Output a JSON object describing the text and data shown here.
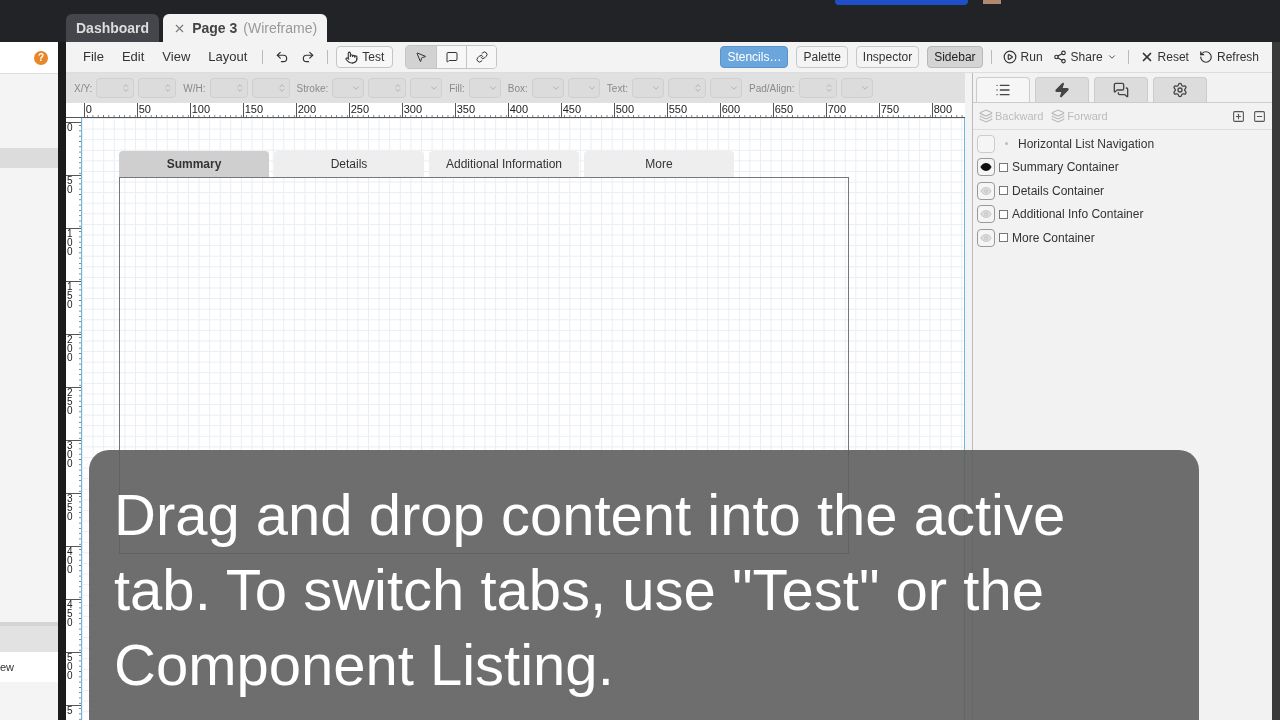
{
  "app_tabs": [
    {
      "label": "Dashboard",
      "selected": false,
      "closable": false
    },
    {
      "label": "Page 3",
      "suffix": "(Wireframe)",
      "selected": true,
      "closable": true
    }
  ],
  "left_panel": {
    "help": "?",
    "fragment": "ew"
  },
  "menu": [
    "File",
    "Edit",
    "View",
    "Layout"
  ],
  "test_button": "Test",
  "mode_tools": [
    {
      "kind": "pointer",
      "selected": true
    },
    {
      "kind": "comment",
      "selected": false
    },
    {
      "kind": "link",
      "selected": false
    }
  ],
  "panel_buttons": [
    {
      "label": "Stencils…",
      "kind": "primary"
    },
    {
      "label": "Palette",
      "kind": "plain"
    },
    {
      "label": "Inspector",
      "kind": "plain"
    },
    {
      "label": "Sidebar",
      "kind": "pressed"
    }
  ],
  "actions": [
    {
      "kind": "run",
      "label": "Run"
    },
    {
      "kind": "share",
      "label": "Share"
    },
    {
      "kind": "reset",
      "label": "Reset"
    },
    {
      "kind": "refresh",
      "label": "Refresh"
    }
  ],
  "property_bar": {
    "disabled": true,
    "groups": [
      {
        "label": "X/Y:",
        "fields": [
          {
            "kind": "stepper"
          },
          {
            "kind": "stepper"
          }
        ]
      },
      {
        "label": "W/H:",
        "fields": [
          {
            "kind": "stepper"
          },
          {
            "kind": "stepper"
          }
        ]
      },
      {
        "label": "Stroke:",
        "fields": [
          {
            "kind": "dropdown"
          },
          {
            "kind": "stepper"
          },
          {
            "kind": "dropdown"
          }
        ]
      },
      {
        "label": "Fill:",
        "fields": [
          {
            "kind": "dropdown"
          }
        ]
      },
      {
        "label": "Box:",
        "fields": [
          {
            "kind": "dropdown"
          },
          {
            "kind": "dropdown"
          }
        ]
      },
      {
        "label": "Text:",
        "fields": [
          {
            "kind": "dropdown"
          },
          {
            "kind": "stepper"
          },
          {
            "kind": "dropdown"
          }
        ]
      },
      {
        "label": "Pad/Align:",
        "fields": [
          {
            "kind": "stepper"
          },
          {
            "kind": "dropdown"
          }
        ]
      }
    ]
  },
  "ruler": {
    "x_labels": [
      "0",
      "50",
      "100",
      "150",
      "200",
      "250",
      "300",
      "350",
      "400",
      "450",
      "500",
      "550",
      "600",
      "650",
      "700",
      "750",
      "800"
    ],
    "y_labels": [
      "0",
      "50",
      "100",
      "150",
      "200",
      "250",
      "300",
      "350",
      "400",
      "450",
      "500",
      "5"
    ]
  },
  "canvas": {
    "tabs": [
      {
        "label": "Summary",
        "selected": true
      },
      {
        "label": "Details",
        "selected": false
      },
      {
        "label": "Additional Information",
        "selected": false
      },
      {
        "label": "More",
        "selected": false
      }
    ]
  },
  "inspector": {
    "tabs": [
      {
        "kind": "list",
        "selected": true
      },
      {
        "kind": "events",
        "selected": false
      },
      {
        "kind": "comments",
        "selected": false
      },
      {
        "kind": "settings",
        "selected": false
      }
    ],
    "history": [
      {
        "label": "Backward",
        "disabled": true
      },
      {
        "label": "Forward",
        "disabled": true
      }
    ],
    "layers": [
      {
        "label": "Horizontal List Navigation",
        "kind": "group"
      },
      {
        "label": "Summary Container",
        "kind": "item",
        "visible": true,
        "checked": false
      },
      {
        "label": "Details Container",
        "kind": "item",
        "visible": false,
        "checked": false
      },
      {
        "label": "Additional Info Container",
        "kind": "item",
        "visible": false,
        "checked": false
      },
      {
        "label": "More Container",
        "kind": "item",
        "visible": false,
        "checked": false
      }
    ]
  },
  "caption": "Drag and drop content into the active tab. To switch tabs, use \"Test\" or the Component Listing."
}
